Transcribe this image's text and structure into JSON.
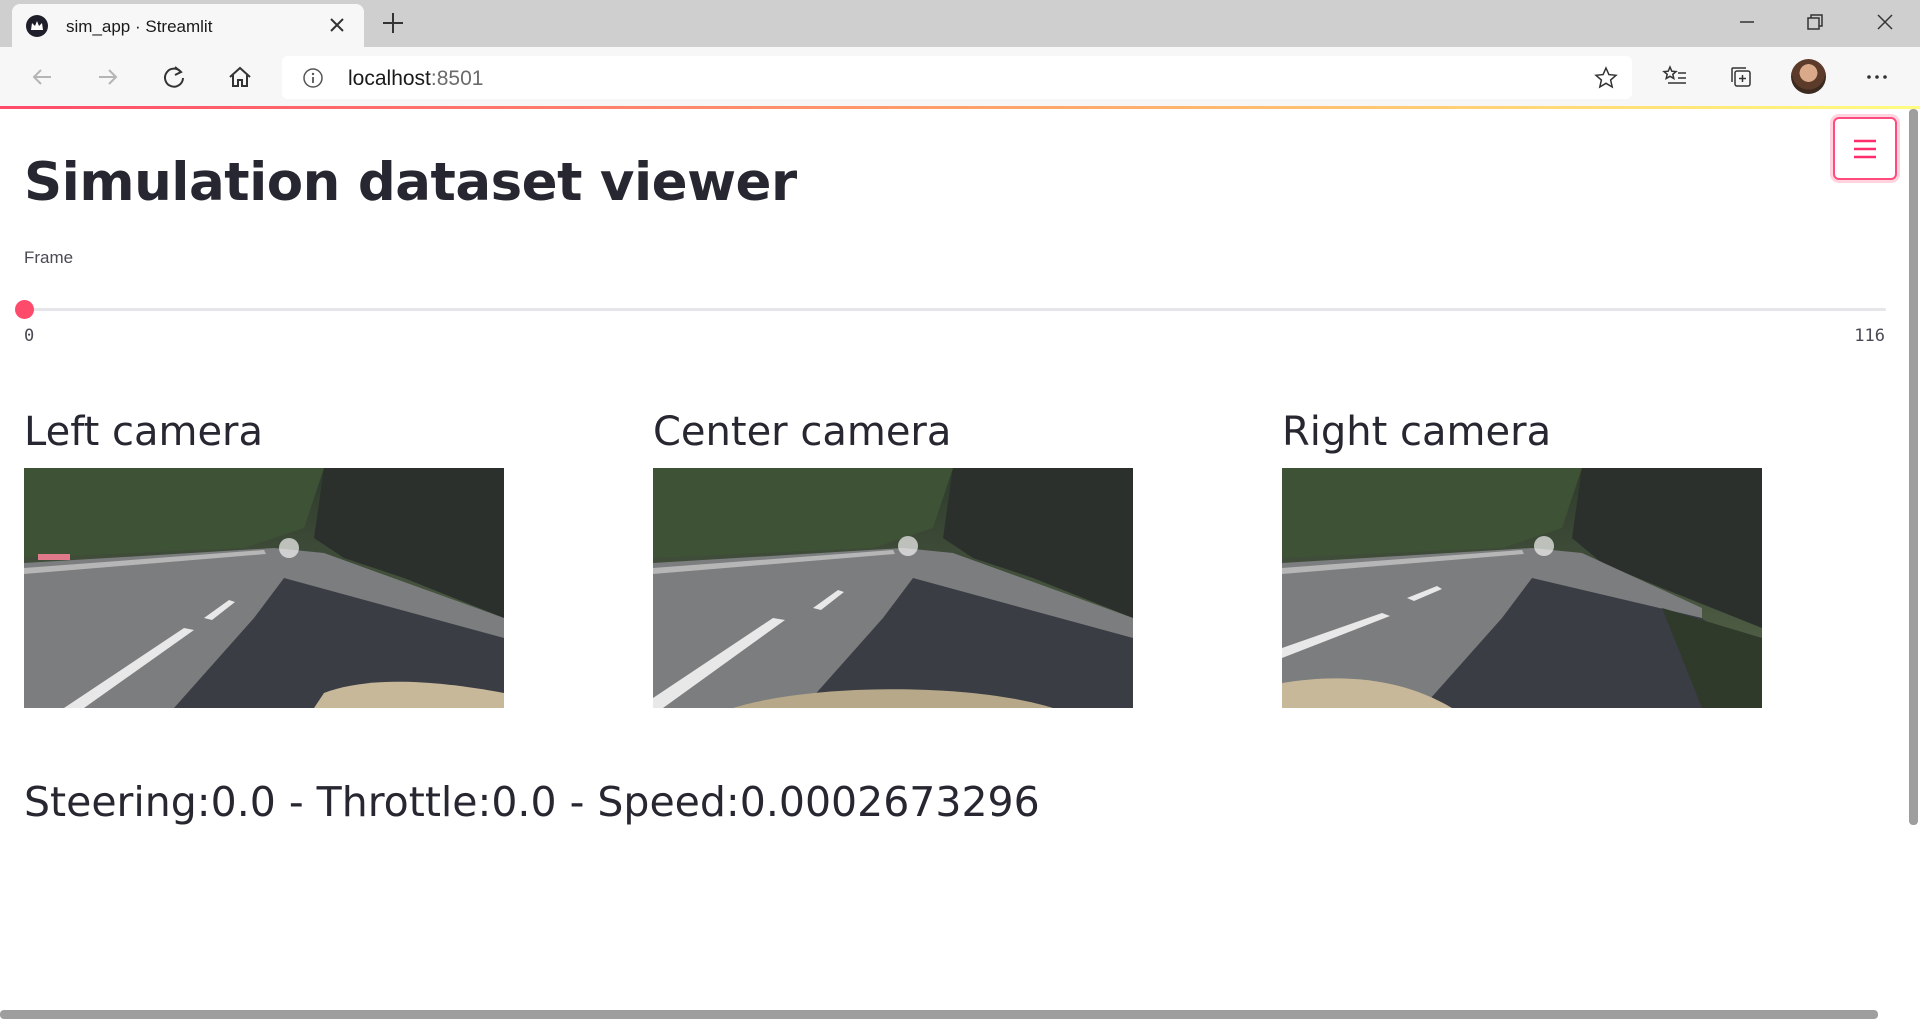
{
  "browser": {
    "tab_title": "sim_app · Streamlit",
    "address_host": "localhost",
    "address_port": ":8501"
  },
  "app": {
    "title": "Simulation dataset viewer",
    "slider": {
      "label": "Frame",
      "min_label": "0",
      "max_label": "116",
      "value": 0,
      "min": 0,
      "max": 116,
      "accent": "#ff4b6b"
    },
    "cameras": [
      {
        "title": "Left camera"
      },
      {
        "title": "Center camera"
      },
      {
        "title": "Right camera"
      }
    ],
    "telemetry": "Steering:0.0 - Throttle:0.0 - Speed:0.0002673296"
  }
}
